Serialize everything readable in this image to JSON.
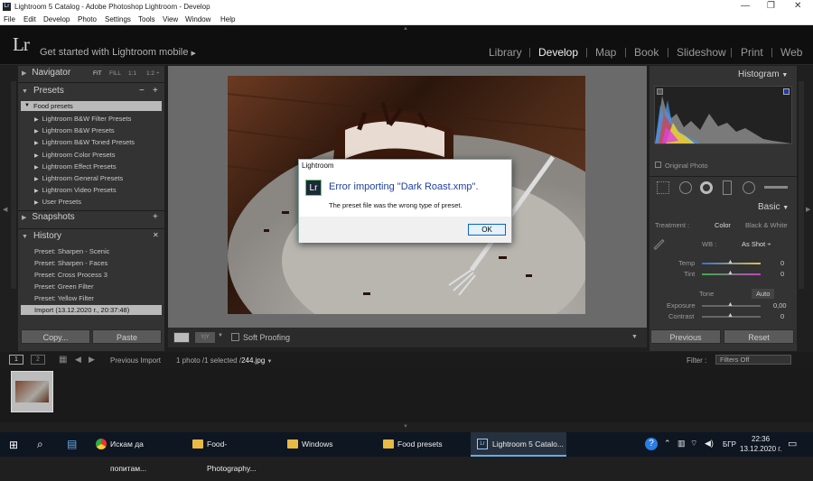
{
  "window": {
    "title": "Lightroom 5 Catalog - Adobe Photoshop Lightroom - Develop",
    "minimize": "—",
    "restore": "❐",
    "close": "✕"
  },
  "menu": [
    "File",
    "Edit",
    "Develop",
    "Photo",
    "Settings",
    "Tools",
    "View",
    "Window",
    "Help"
  ],
  "identity": {
    "logo": "Lr",
    "mobile": "Get started with Lightroom mobile",
    "modules": [
      "Library",
      "Develop",
      "Map",
      "Book",
      "Slideshow",
      "Print",
      "Web"
    ],
    "active": "Develop"
  },
  "left": {
    "navigator": {
      "label": "Navigator",
      "zooms": [
        "FIT",
        "FILL",
        "1:1",
        "1:2 ÷"
      ]
    },
    "presets": {
      "label": "Presets",
      "minus": "−",
      "plus": "+",
      "folder": "Food presets",
      "items": [
        "Lightroom B&W Filter Presets",
        "Lightroom B&W Presets",
        "Lightroom B&W Toned Presets",
        "Lightroom Color Presets",
        "Lightroom Effect Presets",
        "Lightroom General Presets",
        "Lightroom Video Presets",
        "User Presets"
      ]
    },
    "snapshots": {
      "label": "Snapshots",
      "plus": "+"
    },
    "history": {
      "label": "History",
      "close": "✕",
      "items": [
        "Preset: Sharpen - Scenic",
        "Preset: Sharpen - Faces",
        "Preset: Cross Process 3",
        "Preset: Green Filter",
        "Preset: Yellow Filter",
        "Import (13.12.2020 г., 20:37:48)"
      ]
    },
    "copy": "Copy...",
    "paste": "Paste"
  },
  "dialog": {
    "title": "Lightroom",
    "logo": "Lr",
    "heading": "Error importing \"Dark Roast.xmp\".",
    "message": "The preset file was the wrong type of preset.",
    "ok": "OK"
  },
  "toolbar": {
    "soft_proofing": "Soft Proofing",
    "yy": "Y|Y"
  },
  "right": {
    "histogram": {
      "label": "Histogram",
      "original_photo": "Original Photo"
    },
    "basic": {
      "label": "Basic",
      "treatment": "Treatment :",
      "color": "Color",
      "bw": "Black & White",
      "wb_label": "WB :",
      "wb_value": "As Shot ÷",
      "temp_label": "Temp",
      "temp_value": "0",
      "tint_label": "Tint",
      "tint_value": "0",
      "tone": "Tone",
      "auto": "Auto",
      "exposure_label": "Exposure",
      "exposure_value": "0,00",
      "contrast_label": "Contrast",
      "contrast_value": "0"
    },
    "previous": "Previous",
    "reset": "Reset"
  },
  "filmstrip": {
    "view1": "1",
    "view2": "2",
    "source": "Previous Import",
    "count": "1 photo /1 selected /",
    "file": "244.jpg",
    "filter_label": "Filter :",
    "filter_value": "Filters Off"
  },
  "taskbar": {
    "items": [
      "Искам да попитам...",
      "Food-Photography...",
      "Windows",
      "Food presets",
      "Lightroom 5 Catalo..."
    ],
    "lang": "БГР",
    "time": "22:36",
    "date": "13.12.2020 г."
  }
}
